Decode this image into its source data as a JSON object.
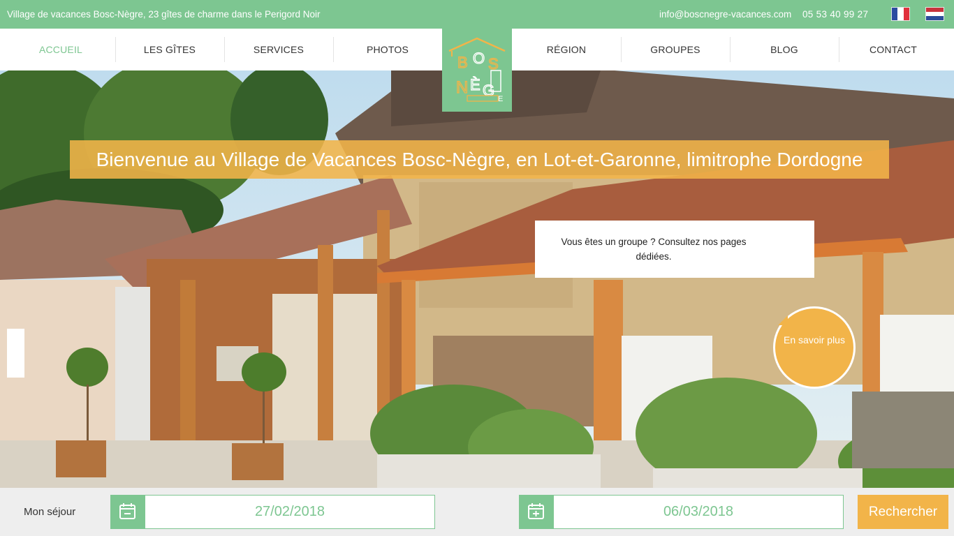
{
  "topbar": {
    "tagline": "Village de vacances Bosc-Nègre, 23 gîtes de charme dans le Perigord Noir",
    "email": "info@boscnegre-vacances.com",
    "phone": "05 53 40 99 27"
  },
  "nav": {
    "items": [
      "ACCUEIL",
      "LES GÎTES",
      "SERVICES",
      "PHOTOS",
      "RÉGION",
      "GROUPES",
      "BLOG",
      "CONTACT"
    ],
    "active": "ACCUEIL"
  },
  "logo": {
    "text": "BOSC NÈGRE"
  },
  "hero": {
    "title": "Bienvenue au Village de Vacances Bosc-Nègre, en Lot-et-Garonne, limitrophe Dordogne"
  },
  "group": {
    "text": "Vous êtes un groupe ? Consultez nos pages dédiées.",
    "button": "En savoir plus"
  },
  "booking": {
    "label": "Mon séjour",
    "arrival": "27/02/2018",
    "departure": "06/03/2018",
    "search": "Rechercher"
  },
  "colors": {
    "green": "#7dc691",
    "orange": "#f2b449"
  },
  "icons": [
    "flag-fr-icon",
    "flag-nl-icon",
    "calendar-minus-icon",
    "calendar-plus-icon"
  ]
}
